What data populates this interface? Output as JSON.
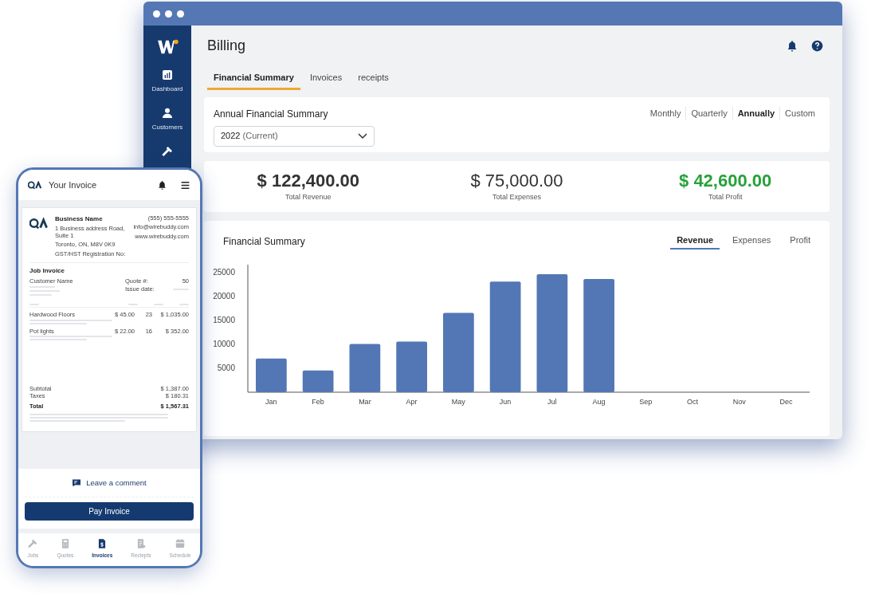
{
  "sidebar": {
    "items": [
      {
        "kind": "chart",
        "label": "Dashboard"
      },
      {
        "kind": "person",
        "label": "Customers"
      },
      {
        "kind": "hammer"
      }
    ]
  },
  "page": {
    "title": "Billing"
  },
  "tabs": [
    {
      "label": "Financial Summary",
      "selected": true
    },
    {
      "label": "Invoices",
      "selected": false
    },
    {
      "label": "receipts",
      "selected": false
    }
  ],
  "summary": {
    "title": "Annual Financial Summary",
    "year": "2022",
    "year_note": "(Current)",
    "periods": [
      {
        "label": "Monthly",
        "selected": false
      },
      {
        "label": "Quarterly",
        "selected": false
      },
      {
        "label": "Annually",
        "selected": true
      },
      {
        "label": "Custom",
        "selected": false
      }
    ]
  },
  "totals": [
    {
      "amount": "$ 122,400.00",
      "label": "Total Revenue",
      "kind": "neutral"
    },
    {
      "amount": "$ 75,000.00",
      "label": "Total Expenses",
      "kind": "neutral"
    },
    {
      "amount": "$ 42,600.00",
      "label": "Total Profit",
      "kind": "positive"
    }
  ],
  "chart_card": {
    "title": "Financial Summary",
    "tabs": [
      {
        "label": "Revenue",
        "selected": true
      },
      {
        "label": "Expenses",
        "selected": false
      },
      {
        "label": "Profit",
        "selected": false
      }
    ],
    "chart_data": {
      "type": "bar",
      "categories": [
        "Jan",
        "Feb",
        "Mar",
        "Apr",
        "May",
        "Jun",
        "Jul",
        "Aug",
        "Sep",
        "Oct",
        "Nov",
        "Dec"
      ],
      "series": [
        {
          "color": "#5377b5",
          "values": [
            7000,
            4500,
            10000,
            10500,
            16500,
            23000,
            24500,
            23500,
            null,
            null,
            null,
            null
          ]
        }
      ],
      "ylim": [
        0,
        26500
      ],
      "yticks": [
        5000,
        10000,
        15000,
        20000,
        25000
      ]
    }
  },
  "phone": {
    "title": "Your Invoice",
    "invoice": {
      "business": "Business Name",
      "address": [
        "1 Business address Road, Suite 1",
        "Toronto, ON, M8V 0K9"
      ],
      "tax_no": "GST/HST Registration No:",
      "contact": [
        "(555) 555-5555",
        "info@wirebuddy.com",
        "www.wirebuddy.com"
      ],
      "heading": "Job Invoice",
      "customer": "Customer Name",
      "meta": [
        {
          "label": "Quote #:",
          "value": "50"
        },
        {
          "label": "Issue date:"
        }
      ],
      "lines": [
        {
          "item": "Hardwood Floors",
          "price": "$ 45.00",
          "qty": "23",
          "total": "$ 1,035.00"
        },
        {
          "item": "Pot lights",
          "price": "$ 22.00",
          "qty": "16",
          "total": "$ 352.00"
        }
      ],
      "sums": [
        {
          "label": "Subtotal",
          "value": "$ 1,387.00",
          "bold": false
        },
        {
          "label": "Taxes",
          "value": "$ 180.31",
          "bold": false
        },
        {
          "label": "Total",
          "value": "$ 1,567.31",
          "bold": true
        }
      ]
    },
    "comment": "Leave a comment",
    "pay": "Pay Invoice",
    "nav": [
      {
        "kind": "hammer",
        "label": "Jobs",
        "selected": false
      },
      {
        "kind": "calculator",
        "label": "Quotes",
        "selected": false
      },
      {
        "kind": "invoice",
        "label": "Invoices",
        "selected": true
      },
      {
        "kind": "receipt",
        "label": "Reciepts",
        "selected": false
      },
      {
        "kind": "calendar",
        "label": "Schedule",
        "selected": false
      }
    ]
  }
}
